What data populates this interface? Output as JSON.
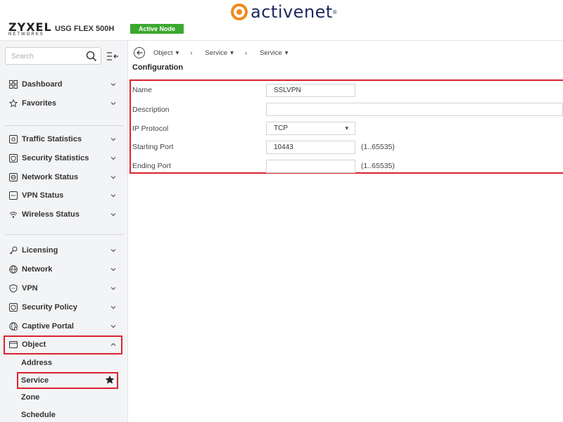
{
  "header": {
    "brand": "ZYXEL",
    "brand_sub": "NETWORKS",
    "model": "USG FLEX 500H",
    "node_badge": "Active Node",
    "partner_logo": "activenet",
    "partner_logo_reg": "®",
    "accent_orange": "#f08a1c",
    "badge_green": "#3aa82e"
  },
  "sidebar": {
    "search_placeholder": "Search",
    "group1": [
      {
        "label": "Dashboard",
        "icon": "dashboard-icon"
      },
      {
        "label": "Favorites",
        "icon": "star-outline-icon"
      }
    ],
    "group2": [
      {
        "label": "Traffic Statistics",
        "icon": "traffic-statistics-icon"
      },
      {
        "label": "Security Statistics",
        "icon": "security-statistics-icon"
      },
      {
        "label": "Network Status",
        "icon": "network-status-icon"
      },
      {
        "label": "VPN Status",
        "icon": "vpn-status-icon"
      },
      {
        "label": "Wireless Status",
        "icon": "wireless-icon"
      }
    ],
    "group3": [
      {
        "label": "Licensing",
        "icon": "key-icon"
      },
      {
        "label": "Network",
        "icon": "globe-icon"
      },
      {
        "label": "VPN",
        "icon": "shield-icon"
      },
      {
        "label": "Security Policy",
        "icon": "security-policy-icon"
      },
      {
        "label": "Captive Portal",
        "icon": "captive-portal-icon"
      },
      {
        "label": "Object",
        "icon": "object-icon",
        "expanded": true
      }
    ],
    "object_sub": [
      "Address",
      "Service",
      "Zone",
      "Schedule"
    ],
    "highlight_color": "#d9232f"
  },
  "breadcrumb": {
    "items": [
      "Object",
      "Service",
      "Service"
    ]
  },
  "main": {
    "title": "Configuration",
    "fields": {
      "name_label": "Name",
      "name_value": "SSLVPN",
      "description_label": "Description",
      "description_value": "",
      "protocol_label": "IP Protocol",
      "protocol_value": "TCP",
      "start_label": "Starting Port",
      "start_value": "10443",
      "start_hint": "(1..65535)",
      "end_label": "Ending Port",
      "end_value": "",
      "end_hint": "(1..65535)"
    }
  }
}
